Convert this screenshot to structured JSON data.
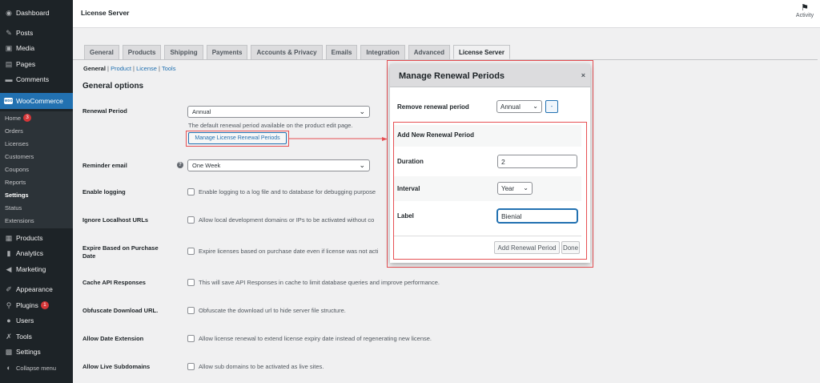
{
  "sidebar": {
    "items": [
      {
        "label": "Dashboard",
        "icon": "dashboard-icon"
      },
      {
        "label": "Posts",
        "icon": "pin-icon"
      },
      {
        "label": "Media",
        "icon": "media-icon"
      },
      {
        "label": "Pages",
        "icon": "pages-icon"
      },
      {
        "label": "Comments",
        "icon": "comments-icon"
      },
      {
        "label": "WooCommerce",
        "icon": "woocommerce-icon",
        "logo_text": "woo"
      },
      {
        "label": "Products",
        "icon": "products-icon"
      },
      {
        "label": "Analytics",
        "icon": "analytics-icon"
      },
      {
        "label": "Marketing",
        "icon": "marketing-icon"
      },
      {
        "label": "Appearance",
        "icon": "appearance-icon"
      },
      {
        "label": "Plugins",
        "icon": "plugins-icon",
        "badge": "1"
      },
      {
        "label": "Users",
        "icon": "users-icon"
      },
      {
        "label": "Tools",
        "icon": "tools-icon"
      },
      {
        "label": "Settings",
        "icon": "settings-icon"
      },
      {
        "label": "Collapse menu",
        "icon": "collapse-icon"
      }
    ],
    "submenu": [
      {
        "label": "Home",
        "badge": "3"
      },
      {
        "label": "Orders"
      },
      {
        "label": "Licenses"
      },
      {
        "label": "Customers"
      },
      {
        "label": "Coupons"
      },
      {
        "label": "Reports"
      },
      {
        "label": "Settings"
      },
      {
        "label": "Status"
      },
      {
        "label": "Extensions"
      }
    ]
  },
  "topbar": {
    "title": "License Server",
    "activity_label": "Activity"
  },
  "tabs": [
    "General",
    "Products",
    "Shipping",
    "Payments",
    "Accounts & Privacy",
    "Emails",
    "Integration",
    "Advanced",
    "License Server"
  ],
  "subsub": {
    "current": "General",
    "links": [
      "Product",
      "License",
      "Tools"
    ],
    "sep": "|"
  },
  "section_title": "General options",
  "settings": {
    "renewal_period": {
      "label": "Renewal Period",
      "value": "Annual",
      "description": "The default renewal period available on the product edit page.",
      "button": "Manage License Renewal Periods"
    },
    "reminder_email": {
      "label": "Reminder email",
      "value": "One Week"
    },
    "enable_logging": {
      "label": "Enable logging",
      "text": "Enable logging to a log file and to database for debugging purpose"
    },
    "ignore_localhost": {
      "label": "Ignore Localhost URLs",
      "text": "Allow local development domains or IPs to be activated without co"
    },
    "expire_based": {
      "label_line1": "Expire Based on Purchase",
      "label_line2": "Date",
      "text": "Expire licenses based on purchase date even if license was not acti"
    },
    "cache_api": {
      "label": "Cache API Responses",
      "text": "This will save API Responses in cache to limit database queries and improve performance."
    },
    "obfuscate": {
      "label": "Obfuscate Download URL.",
      "text": "Obfuscate the download url to hide server file structure."
    },
    "date_extension": {
      "label": "Allow Date Extension",
      "text": "Allow license renewal to extend license expiry date instead of regenerating new license."
    },
    "live_subdomains": {
      "label": "Allow Live Subdomains",
      "text": "Allow sub domains to be activated as live sites."
    }
  },
  "modal": {
    "title": "Manage Renewal Periods",
    "close": "×",
    "remove_label": "Remove renewal period",
    "remove_value": "Annual",
    "remove_button": "-",
    "add_heading": "Add New Renewal Period",
    "duration_label": "Duration",
    "duration_value": "2",
    "interval_label": "Interval",
    "interval_value": "Year",
    "label_label": "Label",
    "label_value": "Bienial",
    "add_button": "Add Renewal Period",
    "done_button": "Done"
  },
  "colors": {
    "accent": "#2271b1",
    "sidebar": "#1d2327",
    "highlight": "#e65054",
    "badge": "#d63638"
  }
}
